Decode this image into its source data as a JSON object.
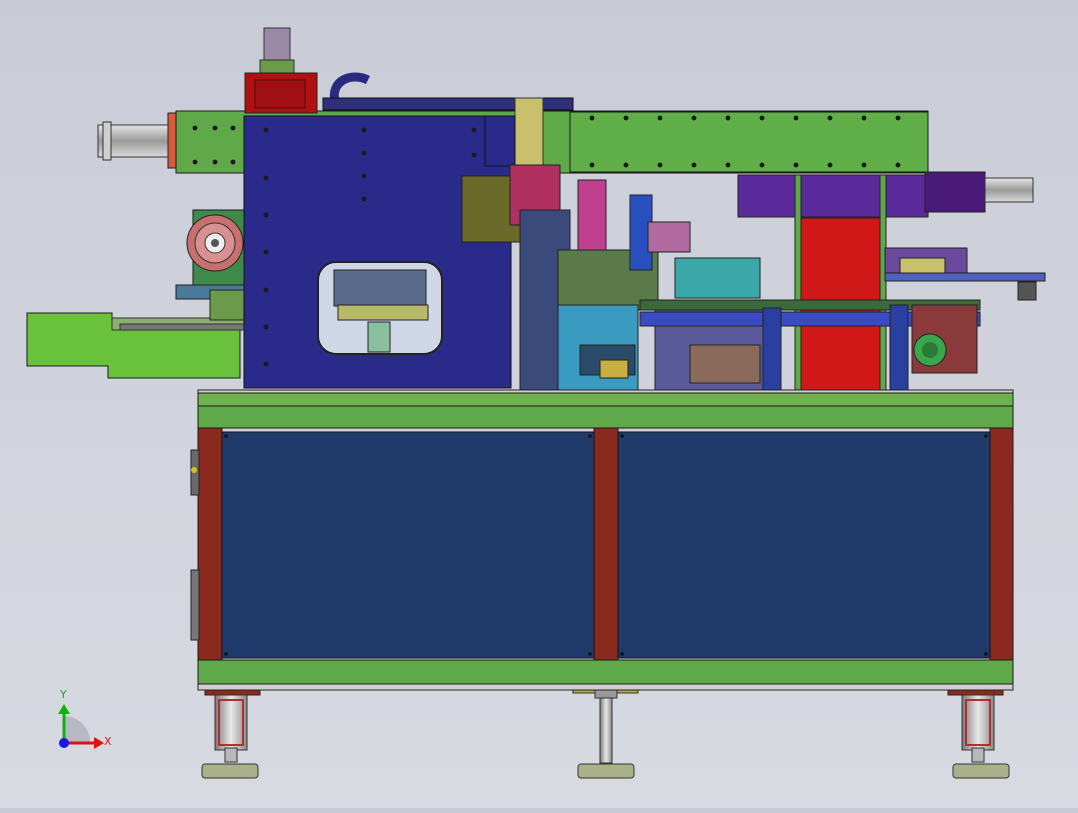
{
  "triad": {
    "y_label": "Y",
    "x_label": "X",
    "x_color": "#e01010",
    "y_color": "#10b010",
    "z_color": "#1818e0"
  },
  "colors": {
    "background": "#d3d5de",
    "frame_green": "#5fa94a",
    "panel_blue": "#1f3a6b",
    "plate_navy": "#2a2a8a",
    "post_red": "#8a2a1e",
    "motor_red": "#b01010",
    "gantry_purple": "#5a2a9a"
  }
}
